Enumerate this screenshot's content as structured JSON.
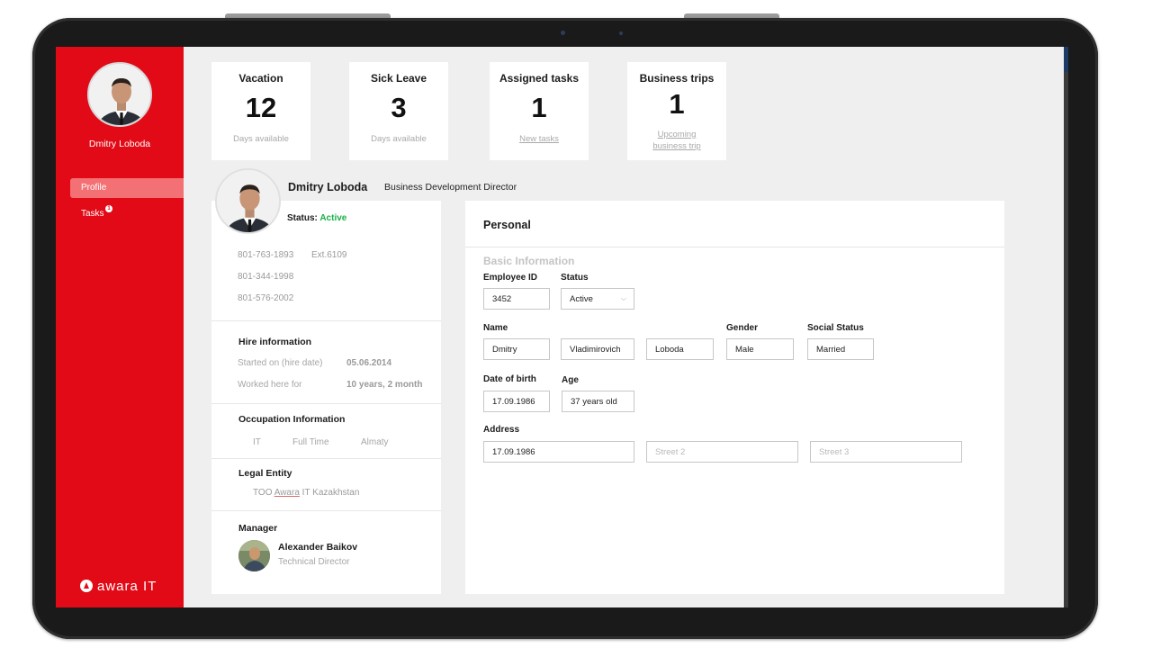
{
  "sidebar": {
    "user_name": "Dmitry Loboda",
    "nav": [
      {
        "label": "Profile",
        "active": true
      },
      {
        "label": "Tasks",
        "badge": "1"
      }
    ],
    "logo_text": "awara IT",
    "accent_color": "#e10a16"
  },
  "cards": [
    {
      "title": "Vacation",
      "value": "12",
      "sub": "Days available"
    },
    {
      "title": "Sick Leave",
      "value": "3",
      "sub": "Days available"
    },
    {
      "title": "Assigned tasks",
      "value": "1",
      "link": "New tasks"
    },
    {
      "title": "Business trips",
      "value": "1",
      "link_line1": "Upcoming",
      "link_line2": "business trip"
    }
  ],
  "employee": {
    "name": "Dmitry Loboda",
    "role": "Business Development Director",
    "status_label": "Status:",
    "status_value": "Active",
    "phones": [
      "801-763-1893",
      "801-344-1998",
      "801-576-2002"
    ],
    "ext": "Ext.6109"
  },
  "hire": {
    "title": "Hire information",
    "started_label": "Started on (hire date)",
    "started_value": "05.06.2014",
    "worked_label": "Worked here for",
    "worked_value": "10 years, 2 month"
  },
  "occupation": {
    "title": "Occupation Information",
    "items": [
      "IT",
      "Full Time",
      "Almaty"
    ]
  },
  "legal": {
    "title": "Legal Entity",
    "prefix": "TOO",
    "underlined": "Awara",
    "suffix": "IT Kazakhstan"
  },
  "manager": {
    "title": "Manager",
    "name": "Alexander Baikov",
    "role": "Technical Director"
  },
  "personal": {
    "title": "Personal",
    "section": "Basic Information",
    "employee_id_label": "Employee ID",
    "employee_id": "3452",
    "status_label": "Status",
    "status_value": "Active",
    "name_label": "Name",
    "first_name": "Dmitry",
    "middle_name": "Vladimirovich",
    "last_name": "Loboda",
    "gender_label": "Gender",
    "gender": "Male",
    "social_label": "Social Status",
    "social": "Married",
    "dob_label": "Date of birth",
    "dob": "17.09.1986",
    "age_label": "Age",
    "age": "37 years old",
    "address_label": "Address",
    "address": "17.09.1986",
    "street2_placeholder": "Street 2",
    "street3_placeholder": "Street 3"
  },
  "colors": {
    "status_active": "#18b04a",
    "nav_active_bg": "#f37075"
  }
}
